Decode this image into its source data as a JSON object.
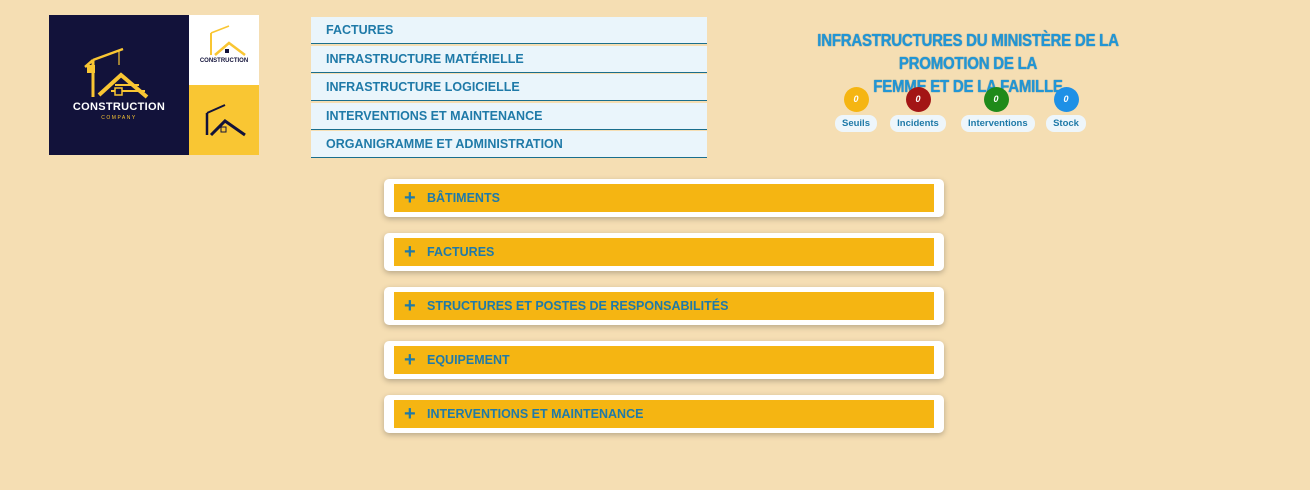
{
  "logo": {
    "brand": "CONSTRUCTION",
    "tagline": "COMPANY",
    "small_brand": "CONSTRUCTION",
    "colors": {
      "navy": "#12123a",
      "gold": "#f9c633",
      "white": "#ffffff"
    }
  },
  "nav": {
    "items": [
      {
        "label": "FACTURES"
      },
      {
        "label": "INFRASTRUCTURE MATÉRIELLE"
      },
      {
        "label": "INFRASTRUCTURE LOGICIELLE"
      },
      {
        "label": "INTERVENTIONS ET MAINTENANCE"
      },
      {
        "label": "ORGANIGRAMME ET ADMINISTRATION"
      }
    ]
  },
  "header": {
    "title_line1": "INFRASTRUCTURES DU MINISTÈRE DE LA PROMOTION DE LA",
    "title_line2": "FEMME ET DE LA FAMILLE"
  },
  "badges": [
    {
      "count": "0",
      "label": "Seuils",
      "color": "#f5b512"
    },
    {
      "count": "0",
      "label": "Incidents",
      "color": "#a31515"
    },
    {
      "count": "0",
      "label": "Interventions",
      "color": "#1f8a1a"
    },
    {
      "count": "0",
      "label": "Stock",
      "color": "#1e90e6"
    }
  ],
  "accordion": {
    "items": [
      {
        "icon": "plus-icon",
        "label": "BÂTIMENTS"
      },
      {
        "icon": "plus-icon",
        "label": "FACTURES"
      },
      {
        "icon": "plus-icon",
        "label": "STRUCTURES ET POSTES DE RESPONSABILITÉS"
      },
      {
        "icon": "plus-icon",
        "label": "EQUIPEMENT"
      },
      {
        "icon": "plus-icon",
        "label": "INTERVENTIONS ET MAINTENANCE"
      }
    ]
  },
  "colors": {
    "background": "#f5deb3",
    "accent_blue": "#1f7aa8",
    "accordion_gold": "#f5b512"
  }
}
